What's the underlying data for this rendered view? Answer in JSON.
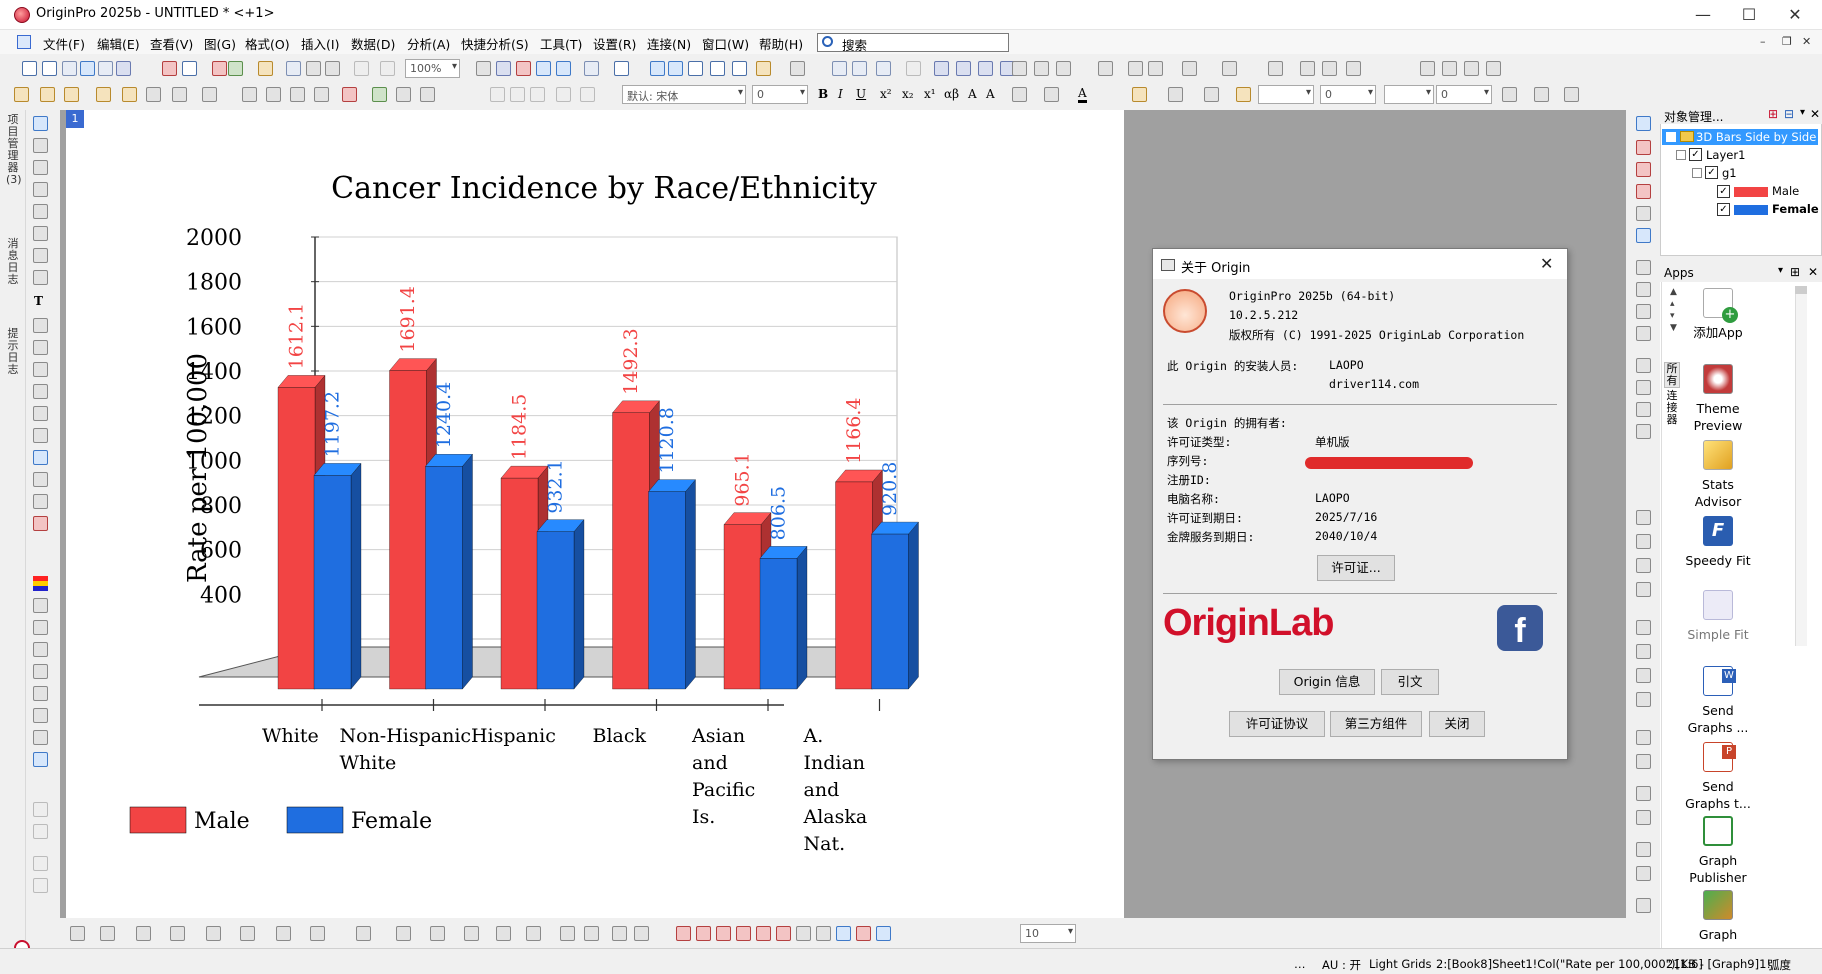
{
  "window": {
    "title": "OriginPro 2025b - UNTITLED * <+1>"
  },
  "menu": [
    "文件(F)",
    "编辑(E)",
    "查看(V)",
    "图(G)",
    "格式(O)",
    "插入(I)",
    "数据(D)",
    "分析(A)",
    "快捷分析(S)",
    "工具(T)",
    "设置(R)",
    "连接(N)",
    "窗口(W)",
    "帮助(H)"
  ],
  "search": {
    "placeholder": "搜索"
  },
  "toolbar": {
    "zoom": "100%",
    "font_name": "默认: 宋体",
    "font_size": "0",
    "num1": "0",
    "num2": "0",
    "bottom_size": "10"
  },
  "left_dock_tabs": [
    "项目管理器 (3)",
    "消息日志",
    "提示日志"
  ],
  "page": {
    "number": "1"
  },
  "chart_data": {
    "type": "bar",
    "title": "Cancer Incidence by Race/Ethnicity",
    "ylabel": "Rate per 100,000",
    "xlabel": "",
    "ylim": [
      200,
      2000
    ],
    "yticks": [
      "400",
      "600",
      "800",
      "1000",
      "1200",
      "1400",
      "1600",
      "1800",
      "2000"
    ],
    "categories": [
      [
        "White"
      ],
      [
        "Non-Hispanic",
        "White"
      ],
      [
        "Hispanic"
      ],
      [
        "Black"
      ],
      [
        "Asian",
        "and",
        "Pacific",
        "Is."
      ],
      [
        "A.",
        "Indian",
        "and",
        "Alaska",
        "Nat."
      ]
    ],
    "series": [
      {
        "name": "Male",
        "color": "#f24444",
        "values": [
          1612.1,
          1691.4,
          1184.5,
          1492.3,
          965.1,
          1166.4
        ],
        "labels": [
          "1612.1",
          "1691.4",
          "1184.5",
          "1492.3",
          "965.1",
          "1166.4"
        ]
      },
      {
        "name": "Female",
        "color": "#1f6ee0",
        "values": [
          1197.2,
          1240.4,
          932.1,
          1120.8,
          806.5,
          920.8
        ],
        "labels": [
          "1197.2",
          "1240.4",
          "932.1",
          "1120.8",
          "806.5",
          "920.8"
        ]
      }
    ],
    "style": "3D bars side by side",
    "grid": true,
    "legend_position": "bottom-left"
  },
  "about_dialog": {
    "title": "关于 Origin",
    "product": "OriginPro 2025b (64-bit)",
    "version": "10.2.5.212",
    "copyright": "版权所有 (C) 1991-2025 OriginLab Corporation",
    "installer_label": "此 Origin 的安装人员:",
    "installer_name": "LAOPO",
    "installer_org": "driver114.com",
    "owner_label": "该 Origin 的拥有者:",
    "license_type_label": "许可证类型:",
    "license_type": "单机版",
    "serial_label": "序列号:",
    "regid_label": "注册ID:",
    "computer_label": "电脑名称:",
    "computer_name": "LAOPO",
    "license_expiry_label": "许可证到期日:",
    "license_expiry": "2025/7/16",
    "service_expiry_label": "金牌服务到期日:",
    "service_expiry": "2040/10/4",
    "license_button": "许可证...",
    "brand": "OriginLab",
    "origin_info_button": "Origin 信息",
    "cite_button": "引文",
    "license_agreement_button": "许可证协议",
    "third_party_button": "第三方组件",
    "close_button": "关闭"
  },
  "object_manager": {
    "title": "对象管理...",
    "root": "3D Bars Side by Side",
    "layer": "Layer1",
    "group": "g1",
    "items": [
      {
        "label": "Male",
        "color": "#f24444"
      },
      {
        "label": "Female",
        "color": "#1f6ee0"
      }
    ]
  },
  "apps": {
    "title": "Apps",
    "side_tabs": [
      "所有",
      "连接器"
    ],
    "items": [
      {
        "label1": "添加App",
        "label2": "",
        "color": "#2f9c3f"
      },
      {
        "label1": "Theme",
        "label2": "Preview",
        "color": "#c23b3b"
      },
      {
        "label1": "Stats",
        "label2": "Advisor",
        "color": "#e0a020"
      },
      {
        "label1": "Speedy Fit",
        "label2": "",
        "color": "#2a5db0"
      },
      {
        "label1": "Simple Fit",
        "label2": "",
        "color": "#b9b9d9"
      },
      {
        "label1": "Send",
        "label2": "Graphs ...",
        "color": "#2b5fb8"
      },
      {
        "label1": "Send",
        "label2": "Graphs t...",
        "color": "#c8442a"
      },
      {
        "label1": "Graph",
        "label2": "Publisher",
        "color": "#2f8f3a"
      },
      {
        "label1": "Graph",
        "label2": "",
        "color": "#d08a2a"
      }
    ]
  },
  "status": {
    "au": "AU : 开",
    "grids": "Light Grids",
    "cell": "2:[Book8]Sheet1!Col(\"Rate per 100,000\")[1:6]",
    "size": "21KB - [Graph9]1!",
    "unit": "弧度"
  }
}
